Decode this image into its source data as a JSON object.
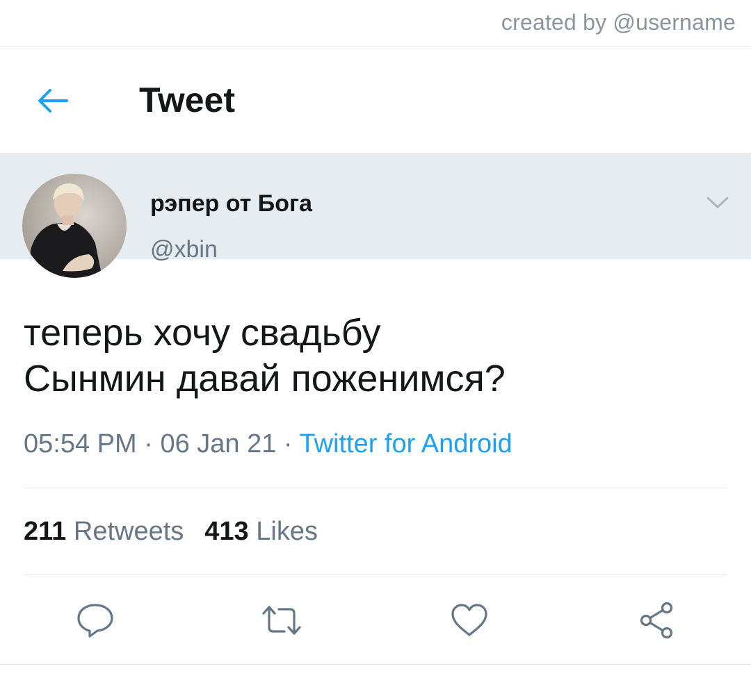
{
  "watermark": "created by @username",
  "header": {
    "title": "Tweet",
    "back_icon": "arrow-left-icon"
  },
  "tweet": {
    "display_name": "рэпер от Бога",
    "handle": "@xbin",
    "text_lines": [
      "теперь хочу свадьбу",
      "Сынмин давай поженимся?"
    ],
    "time": "05:54 PM",
    "date": "06 Jan 21",
    "separator": " · ",
    "source": "Twitter for Android",
    "retweets_count": "211",
    "retweets_label": "Retweets",
    "likes_count": "413",
    "likes_label": "Likes"
  },
  "actions": [
    "reply-icon",
    "retweet-icon",
    "like-icon",
    "share-icon"
  ],
  "colors": {
    "accent": "#1da1f2",
    "secondary_text": "#657786",
    "divider": "#e6ecf0",
    "icon": "#657786"
  }
}
